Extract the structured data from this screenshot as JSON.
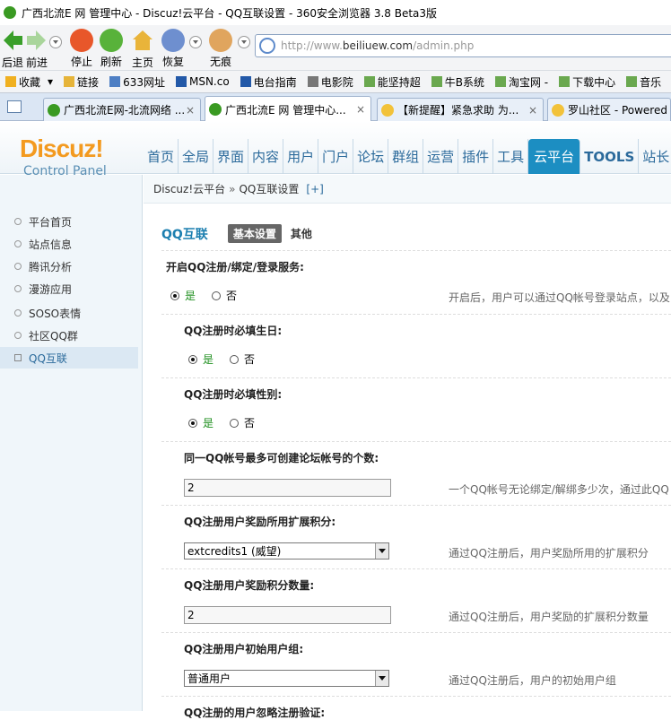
{
  "window": {
    "title": "广西北流E 网 管理中心 - Discuz!云平台 - QQ互联设置 - 360安全浏览器 3.8 Beta3版"
  },
  "toolbar": {
    "back": "后退",
    "forward": "前进",
    "stop": "停止",
    "refresh": "刷新",
    "home": "主页",
    "restore": "恢复",
    "incognito": "无痕"
  },
  "address": {
    "url_prefix": "http://www.",
    "url_domain": "beiliuew.com",
    "url_suffix": "/admin.php"
  },
  "favorites": {
    "label": "收藏",
    "items": [
      "链接",
      "633网址",
      "MSN.co",
      "电台指南",
      "电影院",
      "能坚持超",
      "牛B系统",
      "淘宝网 -",
      "下载中心",
      "音乐"
    ]
  },
  "tabs": [
    {
      "label": "广西北流E网-北流网络 ...",
      "close": "×"
    },
    {
      "label": "广西北流E 网 管理中心...",
      "close": "×"
    },
    {
      "label": "【新提醒】紧急求助 为...",
      "close": "×"
    },
    {
      "label": "罗山社区 - Powered",
      "close": ""
    }
  ],
  "logo": {
    "name": "Discuz!",
    "sub": "Control Panel"
  },
  "nav": [
    "首页",
    "全局",
    "界面",
    "内容",
    "用户",
    "门户",
    "论坛",
    "群组",
    "运营",
    "插件",
    "工具",
    "云平台",
    "TOOLS",
    "站长"
  ],
  "sidebar": [
    "平台首页",
    "站点信息",
    "腾讯分析",
    "漫游应用",
    "SOSO表情",
    "社区QQ群",
    "QQ互联"
  ],
  "breadcrumb": {
    "root": "Discuz!云平台",
    "sep": "»",
    "current": "QQ互联设置",
    "plus": "[+]"
  },
  "page": {
    "title": "QQ互联",
    "tab_basic": "基本设置",
    "tab_other": "其他"
  },
  "settings": {
    "enable_label": "开启QQ注册/绑定/登录服务:",
    "enable_tip": "开启后，用户可以通过QQ帐号登录站点，以及",
    "yes": "是",
    "no": "否",
    "birthday_label": "QQ注册时必填生日:",
    "gender_label": "QQ注册时必填性别:",
    "max_accounts_label": "同一QQ帐号最多可创建论坛帐号的个数:",
    "max_accounts_value": "2",
    "max_accounts_tip": "一个QQ帐号无论绑定/解绑多少次，通过此QQ",
    "credit_label": "QQ注册用户奖励所用扩展积分:",
    "credit_value": "extcredits1 (威望)",
    "credit_tip": "通过QQ注册后，用户奖励所用的扩展积分",
    "credit_amount_label": "QQ注册用户奖励积分数量:",
    "credit_amount_value": "2",
    "credit_amount_tip": "通过QQ注册后，用户奖励的扩展积分数量",
    "group_label": "QQ注册用户初始用户组:",
    "group_value": "普通用户",
    "group_tip": "通过QQ注册后，用户的初始用户组",
    "verify_label": "QQ注册的用户忽略注册验证:"
  }
}
